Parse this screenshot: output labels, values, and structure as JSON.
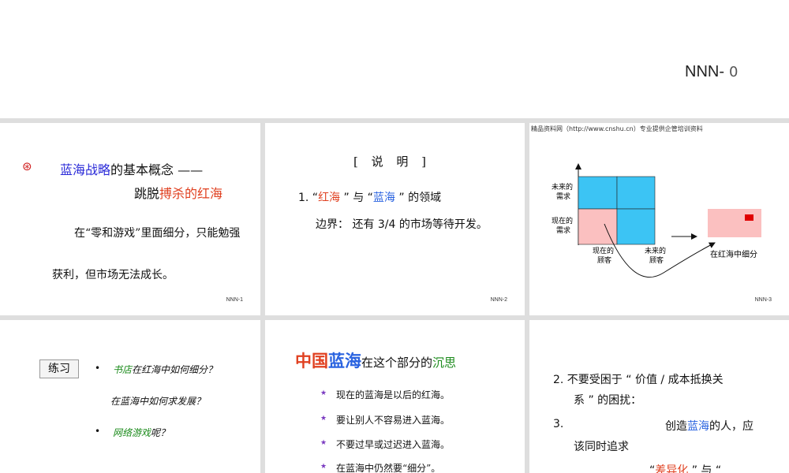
{
  "header": {
    "code": "NNN-",
    "page": "0"
  },
  "slide1": {
    "bullet": "⊛",
    "title_a": "蓝海战略",
    "title_b": "的基本概念 ——",
    "title_c": "跳脱",
    "title_d": "搏杀的红海",
    "para1": "在“零和游戏”里面细分，只能勉强",
    "para2": "获利，但市场无法成长。",
    "num": "NNN-1"
  },
  "slide2": {
    "title": "[ 说 明 ]",
    "line1_a": "1. “",
    "line1_b": "红海",
    "line1_c": " ” 与 “",
    "line1_d": "蓝海",
    "line1_e": " ” 的领域",
    "line2": "边界：  还有 3/4 的市场等待开发。",
    "num": "NNN-2"
  },
  "slide3": {
    "source": "精品资料网（http://www.cnshu.cn）专业提供企管培训资料",
    "label_future_demand": "未来的需求",
    "label_current_demand": "现在的需求",
    "label_current_customer": "现在的顾客",
    "label_future_customer": "未来的顾客",
    "label_subdivide": "在红海中细分",
    "colors": {
      "blue": "#3cc4f4",
      "pink": "#fbc0c0",
      "red": "#e00000"
    },
    "num": "NNN-3"
  },
  "slide4": {
    "box": "练习",
    "q1_a": "书店",
    "q1_b": "在红海中如何细分？",
    "q2": "在蓝海中如何求发展？",
    "q3_a": "网络游戏",
    "q3_b": "呢？"
  },
  "slide5": {
    "title_a": "中国",
    "title_b": "蓝海",
    "title_c": "在这个部分的",
    "title_d": "沉思",
    "items": [
      "现在的蓝海是以后的红海。",
      "要让别人不容易进入蓝海。",
      "不要过早或过迟进入蓝海。",
      "在蓝海中仍然要“细分”。"
    ]
  },
  "slide6": {
    "line1": "2. 不要受困于 “ 价值  / 成本抵换关",
    "line2": "系 ” 的困扰：",
    "line3_num": "3.",
    "line3_a": "创造",
    "line3_b": "蓝海",
    "line3_c": "的人，应",
    "line4": "该同时追求",
    "line5_a": "“",
    "line5_b": "差异化",
    "line5_c": " ” 与 “"
  }
}
